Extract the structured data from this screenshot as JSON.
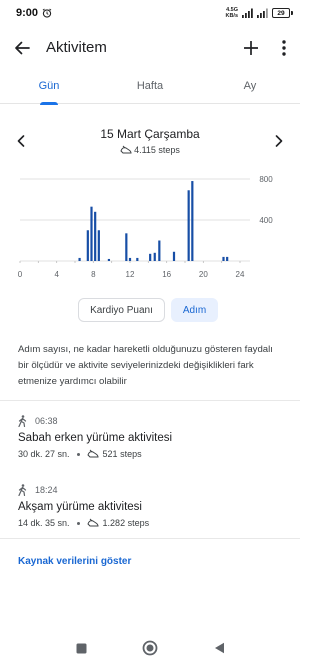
{
  "status_bar": {
    "time": "9:00",
    "net_speed_top": "4.5G",
    "net_speed_bottom": "KB/s",
    "battery": "29"
  },
  "app_bar": {
    "title": "Aktivitem"
  },
  "tabs": [
    {
      "label": "Gün",
      "active": true
    },
    {
      "label": "Hafta",
      "active": false
    },
    {
      "label": "Ay",
      "active": false
    }
  ],
  "date_nav": {
    "date": "15 Mart Çarşamba",
    "steps": "4.115 steps"
  },
  "chart_data": {
    "type": "bar",
    "x_unit": "hour",
    "xlim": [
      0,
      24
    ],
    "ylim": [
      0,
      1000
    ],
    "yticks": [
      400,
      800
    ],
    "xticks": [
      0,
      4,
      8,
      12,
      16,
      20,
      24
    ],
    "x": [
      6.5,
      7.4,
      7.8,
      8.2,
      8.6,
      9.7,
      11.6,
      12.0,
      12.8,
      14.2,
      14.7,
      15.2,
      16.8,
      18.4,
      18.8,
      22.2,
      22.6
    ],
    "values": [
      30,
      300,
      530,
      480,
      300,
      20,
      270,
      30,
      30,
      70,
      80,
      200,
      90,
      690,
      780,
      40,
      40
    ],
    "colors": {
      "bar": "#174ea6",
      "grid": "#e0e0e0",
      "axis": "#5f6368"
    }
  },
  "metric_toggle": {
    "option_1": "Kardiyo Puanı",
    "option_2": "Adım",
    "selected": "Adım"
  },
  "info_text": "Adım sayısı, ne kadar hareketli olduğunuzu gösteren faydalı bir ölçüdür ve aktivite seviyelerinizdeki değişiklikleri fark etmenize yardımcı olabilir",
  "sessions": [
    {
      "time": "06:38",
      "title": "Sabah erken yürüme aktivitesi",
      "duration": "30 dk. 27 sn.",
      "steps": "521 steps"
    },
    {
      "time": "18:24",
      "title": "Akşam yürüme aktivitesi",
      "duration": "14 dk. 35 sn.",
      "steps": "1.282 steps"
    }
  ],
  "source_link": "Kaynak verilerini göster",
  "theme": {
    "accent": "#1a73e8",
    "chip_bg": "#e8f0fe",
    "icon": "#5f6368"
  }
}
